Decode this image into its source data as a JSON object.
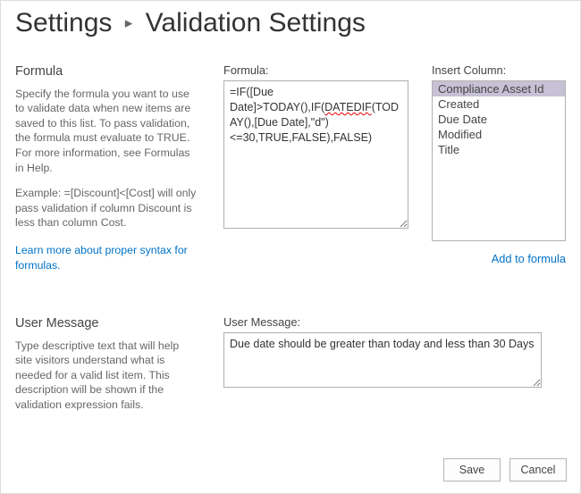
{
  "breadcrumb": {
    "root": "Settings",
    "current": "Validation Settings"
  },
  "formula_section": {
    "title": "Formula",
    "help": "Specify the formula you want to use to validate data when new items are saved to this list. To pass validation, the formula must evaluate to TRUE. For more information, see Formulas in Help.",
    "example": "Example: =[Discount]<[Cost] will only pass validation if column Discount is less than column Cost.",
    "learn_link": "Learn more about proper syntax for formulas.",
    "field_label": "Formula:",
    "formula_parts": {
      "pre": "=IF([Due Date]>TODAY(),IF(",
      "spell": "DATEDIF",
      "post": "(TODAY(),[Due Date],\"d\")<=30,TRUE,FALSE),FALSE)"
    },
    "formula_plain": "=IF([Due Date]>TODAY(),IF(DATEDIF(TODAY(),[Due Date],\"d\")<=30,TRUE,FALSE),FALSE)"
  },
  "insert_column": {
    "label": "Insert Column:",
    "items": [
      "Compliance Asset Id",
      "Created",
      "Due Date",
      "Modified",
      "Title"
    ],
    "selected_index": 0,
    "add_link": "Add to formula"
  },
  "message_section": {
    "title": "User Message",
    "help": "Type descriptive text that will help site visitors understand what is needed for a valid list item. This description will be shown if the validation expression fails.",
    "field_label": "User Message:",
    "value": "Due date should be greater than today and less than 30 Days"
  },
  "buttons": {
    "save": "Save",
    "cancel": "Cancel"
  }
}
